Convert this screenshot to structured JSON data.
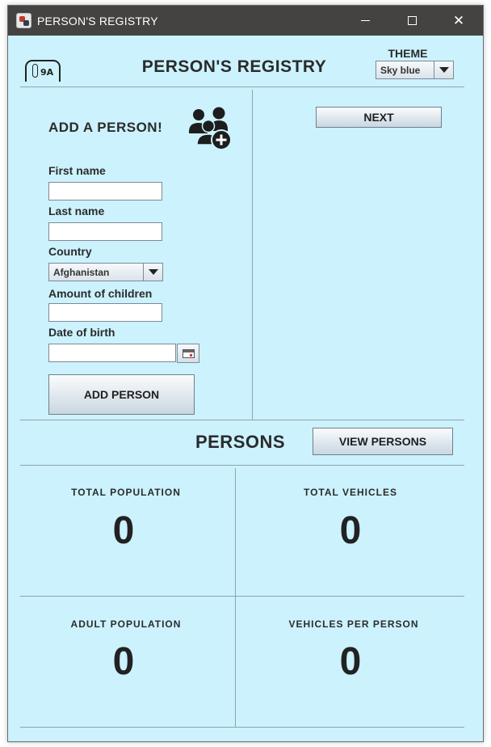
{
  "window": {
    "title": "PERSON'S REGISTRY",
    "icon": "app-icon",
    "controls": [
      "minimize",
      "maximize",
      "close"
    ]
  },
  "header": {
    "logo_text": "9A",
    "title": "PERSON'S REGISTRY",
    "theme_label": "THEME",
    "theme_value": "Sky blue"
  },
  "add_form": {
    "title": "ADD A PERSON!",
    "icon": "add-group-icon",
    "fields": {
      "first_name": {
        "label": "First name",
        "value": ""
      },
      "last_name": {
        "label": "Last name",
        "value": ""
      },
      "country": {
        "label": "Country",
        "value": "Afghanistan"
      },
      "children": {
        "label": "Amount of children",
        "value": ""
      },
      "dob": {
        "label": "Date of birth",
        "value": ""
      }
    },
    "submit_label": "ADD PERSON"
  },
  "next_label": "NEXT",
  "persons": {
    "title": "PERSONS",
    "view_label": "VIEW PERSONS"
  },
  "stats": {
    "total_population": {
      "label": "TOTAL POPULATION",
      "value": "0"
    },
    "total_vehicles": {
      "label": "TOTAL VEHICLES",
      "value": "0"
    },
    "adult_population": {
      "label": "ADULT POPULATION",
      "value": "0"
    },
    "vehicles_per_person": {
      "label": "VEHICLES PER PERSON",
      "value": "0"
    }
  },
  "colors": {
    "background": "#ccf2fd",
    "titlebar": "#444342",
    "text": "#2b2b2b",
    "divider": "#8fa3b0"
  }
}
